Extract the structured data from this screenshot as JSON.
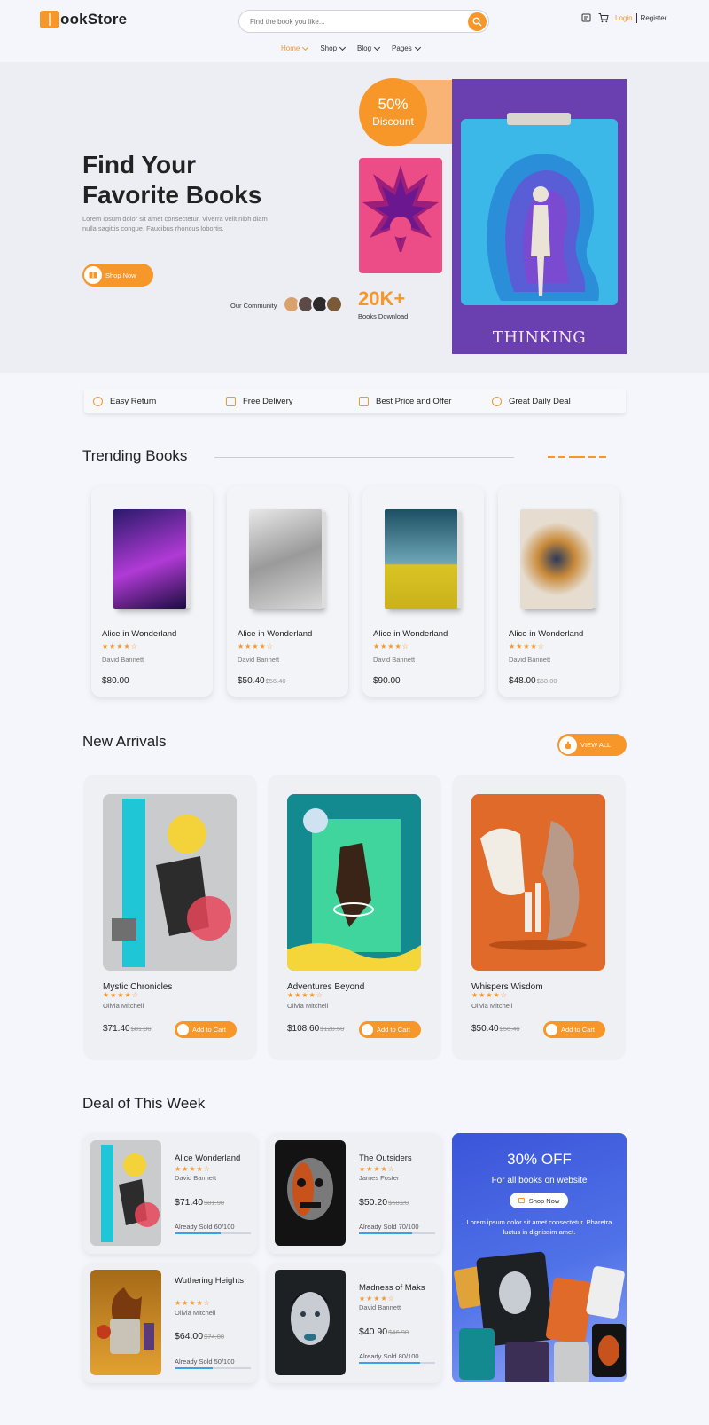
{
  "brand": {
    "logo_letter": "B",
    "logo_rest": "ookStore",
    "accent": "#f7972a"
  },
  "search": {
    "placeholder": "Find the book you like..."
  },
  "auth": {
    "login": "Login",
    "register": "Register"
  },
  "nav": [
    {
      "label": "Home",
      "active": true
    },
    {
      "label": "Shop"
    },
    {
      "label": "Blog"
    },
    {
      "label": "Pages"
    }
  ],
  "hero": {
    "title_line1": "Find Your",
    "title_line2": "Favorite Books",
    "description": "Lorem ipsum dolor sit amet consectetur. Viverra velit nibh diam nulla sagittis congue. Faucibus rhoncus lobortis.",
    "cta": "Shop Now",
    "community_label": "Our Community",
    "stat_number": "20K+",
    "stat_label": "Books Download",
    "discount_pct": "50%",
    "discount_label": "Discount",
    "book_title": "THINKING"
  },
  "features": [
    "Easy Return",
    "Free Delivery",
    "Best Price and Offer",
    "Great Daily Deal"
  ],
  "trending": {
    "title": "Trending Books",
    "books": [
      {
        "title": "Alice in Wonderland",
        "rating": "★★★★☆",
        "author": "David Bannett",
        "price": "$80.00",
        "old_price": ""
      },
      {
        "title": "Alice in Wonderland",
        "rating": "★★★★☆",
        "author": "David Bannett",
        "price": "$50.40",
        "old_price": "$56.40"
      },
      {
        "title": "Alice in Wonderland",
        "rating": "★★★★☆",
        "author": "David Bannett",
        "price": "$90.00",
        "old_price": ""
      },
      {
        "title": "Alice in Wonderland",
        "rating": "★★★★☆",
        "author": "David Bannett",
        "price": "$48.00",
        "old_price": "$58.00"
      }
    ]
  },
  "arrivals": {
    "title": "New Arrivals",
    "view_all": "VIEW ALL",
    "books": [
      {
        "title": "Mystic Chronicles",
        "rating": "★★★★☆",
        "author": "Olivia Mitchell",
        "price": "$71.40",
        "old_price": "$81.90",
        "cta": "Add to Cart"
      },
      {
        "title": "Adventures Beyond",
        "rating": "★★★★☆",
        "author": "Olivia Mitchell",
        "price": "$108.60",
        "old_price": "$120.50",
        "cta": "Add to Cart"
      },
      {
        "title": "Whispers Wisdom",
        "rating": "★★★★☆",
        "author": "Olivia Mitchell",
        "price": "$50.40",
        "old_price": "$56.40",
        "cta": "Add to Cart"
      }
    ]
  },
  "deals": {
    "title": "Deal of This Week",
    "books": [
      {
        "title": "Alice Wonderland",
        "rating": "★★★★☆",
        "author": "David Bannett",
        "price": "$71.40",
        "old_price": "$81.90",
        "sold": "Already Sold 60/100",
        "sold_fraction": 0.6
      },
      {
        "title": "The Outsiders",
        "rating": "★★★★☆",
        "author": "James Foster",
        "price": "$50.20",
        "old_price": "$58.20",
        "sold": "Already Sold 70/100",
        "sold_fraction": 0.7
      },
      {
        "title": "Wuthering Heights",
        "rating": "★★★★☆",
        "author": "Olivia Mitchell",
        "price": "$64.00",
        "old_price": "$74.00",
        "sold": "Already Sold 50/100",
        "sold_fraction": 0.5
      },
      {
        "title": "Madness of Maks",
        "rating": "★★★★☆",
        "author": "David Bannett",
        "price": "$40.90",
        "old_price": "$46.90",
        "sold": "Already Sold 80/100",
        "sold_fraction": 0.8
      }
    ],
    "promo": {
      "title": "30% OFF",
      "subtitle": "For all books on website",
      "cta": "Shop Now",
      "text": "Lorem ipsum dolor sit amet consectetur. Pharetra luctus in dignissim amet."
    }
  }
}
